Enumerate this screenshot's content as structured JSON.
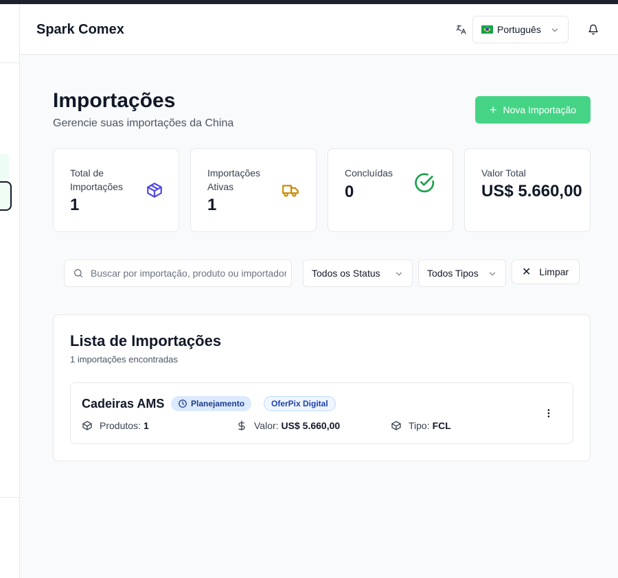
{
  "header": {
    "brand": "Spark Comex",
    "language": "Português"
  },
  "page": {
    "title": "Importações",
    "subtitle": "Gerencie suas importações da China",
    "new_button": "Nova Importação"
  },
  "stats": [
    {
      "label": "Total de Importações",
      "value": "1",
      "icon": "package-icon",
      "color": "#4f46e5"
    },
    {
      "label": "Importações Ativas",
      "value": "1",
      "icon": "truck-icon",
      "color": "#ca8a04"
    },
    {
      "label": "Concluídas",
      "value": "0",
      "icon": "check-circle-icon",
      "color": "#16a34a"
    },
    {
      "label": "Valor Total",
      "value": "US$ 5.660,00"
    }
  ],
  "filters": {
    "search_placeholder": "Buscar por importação, produto ou importador...",
    "status": "Todos os Status",
    "type": "Todos Tipos",
    "clear": "Limpar"
  },
  "list": {
    "title": "Lista de Importações",
    "count_text": "1 importações encontradas",
    "items": [
      {
        "name": "Cadeiras AMS",
        "status": "Planejamento",
        "importer": "OferPix Digital",
        "products_label": "Produtos:",
        "products": "1",
        "value_label": "Valor:",
        "value": "US$ 5.660,00",
        "type_label": "Tipo:",
        "type": "FCL"
      }
    ]
  },
  "colors": {
    "accent": "#45d486",
    "badge_blue": "#dbeafe"
  }
}
